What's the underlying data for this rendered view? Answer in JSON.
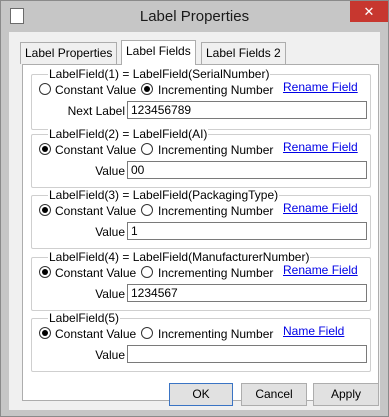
{
  "window": {
    "title": "Label Properties",
    "close_glyph": "✕"
  },
  "tabs": [
    {
      "label": "Label Properties",
      "active": false
    },
    {
      "label": "Label Fields",
      "active": true
    },
    {
      "label": "Label Fields 2",
      "active": false
    }
  ],
  "groups": [
    {
      "legend": "LabelField(1) = LabelField(SerialNumber)",
      "constant_label": "Constant Value",
      "incrementing_label": "Incrementing Number",
      "selected": "incrementing",
      "link": "Rename Field",
      "value_label": "Next Label",
      "value": "123456789"
    },
    {
      "legend": "LabelField(2) = LabelField(AI)",
      "constant_label": "Constant Value",
      "incrementing_label": "Incrementing Number",
      "selected": "constant",
      "link": "Rename Field",
      "value_label": "Value",
      "value": "00"
    },
    {
      "legend": "LabelField(3) = LabelField(PackagingType)",
      "constant_label": "Constant Value",
      "incrementing_label": "Incrementing Number",
      "selected": "constant",
      "link": "Rename Field",
      "value_label": "Value",
      "value": "1"
    },
    {
      "legend": "LabelField(4) = LabelField(ManufacturerNumber)",
      "constant_label": "Constant Value",
      "incrementing_label": "Incrementing Number",
      "selected": "constant",
      "link": "Rename Field",
      "value_label": "Value",
      "value": "1234567"
    },
    {
      "legend": "LabelField(5)",
      "constant_label": "Constant Value",
      "incrementing_label": "Incrementing Number",
      "selected": "constant",
      "link": "Name Field",
      "value_label": "Value",
      "value": ""
    }
  ],
  "buttons": {
    "ok": "OK",
    "cancel": "Cancel",
    "apply": "Apply"
  },
  "colors": {
    "link": "#0000e6",
    "close_button": "#c7372f",
    "default_button_border": "#3a74c4"
  }
}
